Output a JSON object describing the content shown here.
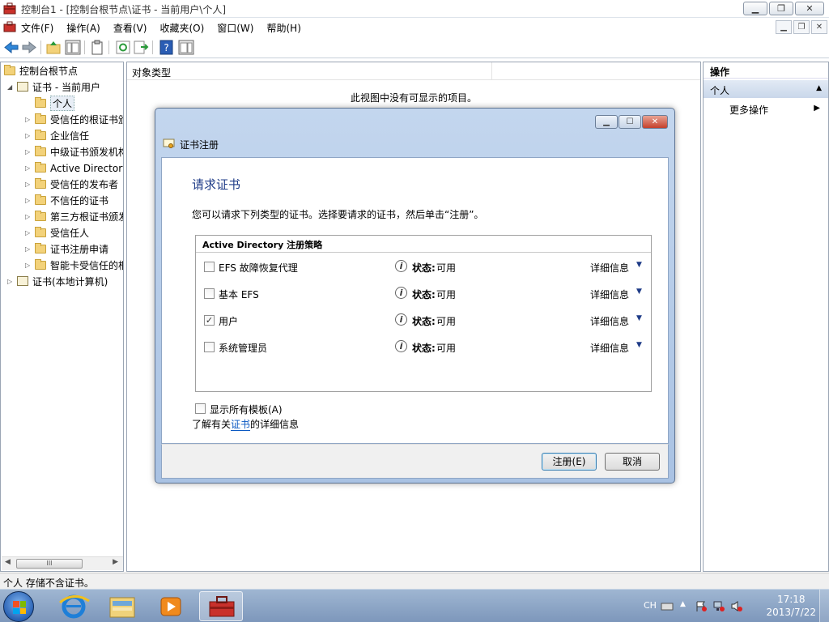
{
  "window": {
    "title": "控制台1 - [控制台根节点\\证书 - 当前用户\\个人]"
  },
  "menu": [
    "文件(F)",
    "操作(A)",
    "查看(V)",
    "收藏夹(O)",
    "窗口(W)",
    "帮助(H)"
  ],
  "tree": {
    "root": "控制台根节点",
    "current_user": "证书 - 当前用户",
    "items": [
      "个人",
      "受信任的根证书颁发机构",
      "企业信任",
      "中级证书颁发机构",
      "Active Directory 用户对象",
      "受信任的发布者",
      "不信任的证书",
      "第三方根证书颁发机构",
      "受信任人",
      "证书注册申请",
      "智能卡受信任的根"
    ],
    "local_computer": "证书(本地计算机)",
    "scroll_thumb": "III"
  },
  "center": {
    "column_header": "对象类型",
    "empty_message": "此视图中没有可显示的项目。"
  },
  "actions": {
    "header": "操作",
    "section": "个人",
    "more": "更多操作"
  },
  "status": "个人 存储不含证书。",
  "dialog": {
    "title": "证书注册",
    "heading": "请求证书",
    "description": "您可以请求下列类型的证书。选择要请求的证书，然后单击“注册”。",
    "policy_title": "Active Directory 注册策略",
    "status_label": "状态:",
    "details_label": "详细信息",
    "rows": [
      {
        "name": "EFS 故障恢复代理",
        "status": "可用",
        "checked": false
      },
      {
        "name": "基本 EFS",
        "status": "可用",
        "checked": false
      },
      {
        "name": "用户",
        "status": "可用",
        "checked": true
      },
      {
        "name": "系统管理员",
        "status": "可用",
        "checked": false
      }
    ],
    "show_all": "显示所有模板(A)",
    "learn_prefix": "了解有关",
    "learn_link": "证书",
    "learn_suffix": "的详细信息",
    "enroll_button": "注册(E)",
    "cancel_button": "取消"
  },
  "taskbar": {
    "lang": "CH",
    "time": "17:18",
    "date": "2013/7/22"
  },
  "colors": {
    "accent": "#1e3b87",
    "link": "#0a58c2",
    "dialog_frame": "#a9c2e3"
  }
}
